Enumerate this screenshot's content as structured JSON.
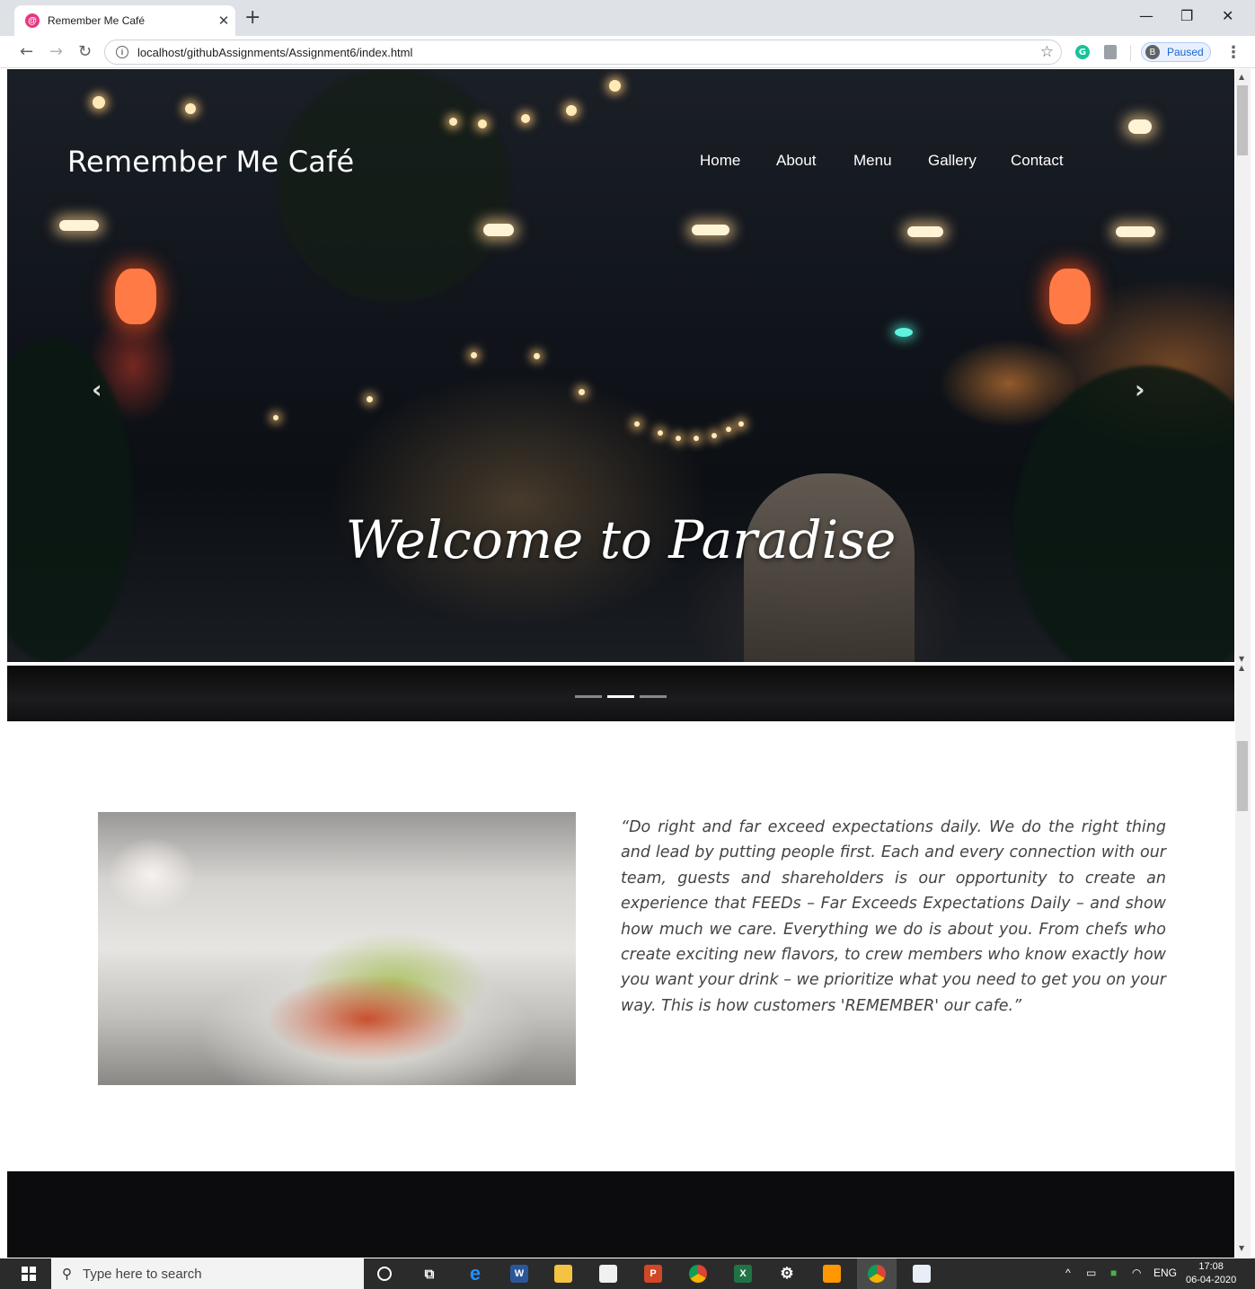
{
  "browser": {
    "tab_title": "Remember Me Café",
    "favicon_letter": "@",
    "url": "localhost/githubAssignments/Assignment6/index.html",
    "profile_initial": "B",
    "profile_status": "Paused",
    "ext_grammarly": "G"
  },
  "site": {
    "brand": "Remember Me Café",
    "nav": [
      "Home",
      "About",
      "Menu",
      "Gallery",
      "Contact"
    ],
    "hero_caption": "Welcome to Paradise",
    "carousel": {
      "slides": 3,
      "active_index": 1
    },
    "about_quote": "“Do right and far exceed expectations daily. We do the right thing and lead by putting people first. Each and every connection with our team, guests and shareholders is our opportunity to create an experience that FEEDs – Far Exceeds Expectations Daily – and show how much we care. Everything we do is about you. From chefs who create exciting new flavors, to crew members who know exactly how you want your drink – we prioritize what you need to get you on your way. This is how customers 'REMEMBER' our cafe.”"
  },
  "taskbar": {
    "search_placeholder": "Type here to search",
    "language": "ENG",
    "time": "17:08",
    "date": "06-04-2020",
    "word_label": "W",
    "ppt_label": "P",
    "excel_label": "X"
  },
  "colors": {
    "accent": "#1967d2",
    "favicon": "#e53980",
    "taskbar": "#2b2b2b"
  }
}
